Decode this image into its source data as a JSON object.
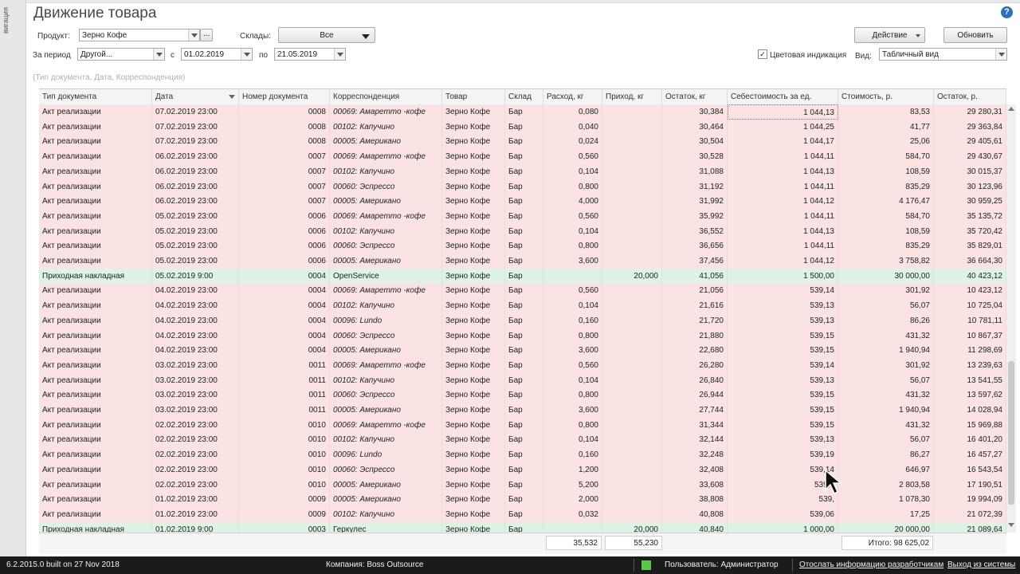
{
  "left_strip_text": "вигация",
  "title": "Движение товара",
  "form": {
    "product_label": "Продукт:",
    "product_value": "Зерно Кофе",
    "product_more": "...",
    "stores_label": "Склады:",
    "stores_value": "Все",
    "period_label": "За период",
    "period_value": "Другой...",
    "from_label": "с",
    "from_value": "01.02.2019",
    "to_label": "по",
    "to_value": "21.05.2019",
    "color_label": "Цветовая индикация",
    "view_label": "Вид:",
    "view_value": "Табличный вид",
    "action_btn": "Действие",
    "refresh_btn": "Обновить",
    "filter_placeholder": "(Тип документа, Дата, Корреспонденция)"
  },
  "columns": [
    "Тип документа",
    "Дата",
    "Номер документа",
    "Корреспонденция",
    "Товар",
    "Склад",
    "Расход, кг",
    "Приход, кг",
    "Остаток, кг",
    "Себестоимость за ед.",
    "Стоимость, р.",
    "Остаток, р."
  ],
  "rows": [
    {
      "kind": "sale",
      "type": "Акт реализации",
      "date": "07.02.2019 23:00",
      "num": "0008",
      "corr": "00069: Амаретто -кофе",
      "item": "Зерно Кофе",
      "store": "Бар",
      "out": "0,080",
      "in": "",
      "bal": "30,384",
      "unit": "1 044,13",
      "cost": "83,53",
      "balr": "29 280,31"
    },
    {
      "kind": "sale",
      "type": "Акт реализации",
      "date": "07.02.2019 23:00",
      "num": "0008",
      "corr": "00102: Капучино",
      "item": "Зерно Кофе",
      "store": "Бар",
      "out": "0,040",
      "in": "",
      "bal": "30,464",
      "unit": "1 044,25",
      "cost": "41,77",
      "balr": "29 363,84"
    },
    {
      "kind": "sale",
      "type": "Акт реализации",
      "date": "07.02.2019 23:00",
      "num": "0008",
      "corr": "00005: Американо",
      "item": "Зерно Кофе",
      "store": "Бар",
      "out": "0,024",
      "in": "",
      "bal": "30,504",
      "unit": "1 044,17",
      "cost": "25,06",
      "balr": "29 405,61"
    },
    {
      "kind": "sale",
      "type": "Акт реализации",
      "date": "06.02.2019 23:00",
      "num": "0007",
      "corr": "00069: Амаретто -кофе",
      "item": "Зерно Кофе",
      "store": "Бар",
      "out": "0,560",
      "in": "",
      "bal": "30,528",
      "unit": "1 044,11",
      "cost": "584,70",
      "balr": "29 430,67"
    },
    {
      "kind": "sale",
      "type": "Акт реализации",
      "date": "06.02.2019 23:00",
      "num": "0007",
      "corr": "00102: Капучино",
      "item": "Зерно Кофе",
      "store": "Бар",
      "out": "0,104",
      "in": "",
      "bal": "31,088",
      "unit": "1 044,13",
      "cost": "108,59",
      "balr": "30 015,37"
    },
    {
      "kind": "sale",
      "type": "Акт реализации",
      "date": "06.02.2019 23:00",
      "num": "0007",
      "corr": "00060: Эспрессо",
      "item": "Зерно Кофе",
      "store": "Бар",
      "out": "0,800",
      "in": "",
      "bal": "31,192",
      "unit": "1 044,11",
      "cost": "835,29",
      "balr": "30 123,96"
    },
    {
      "kind": "sale",
      "type": "Акт реализации",
      "date": "06.02.2019 23:00",
      "num": "0007",
      "corr": "00005: Американо",
      "item": "Зерно Кофе",
      "store": "Бар",
      "out": "4,000",
      "in": "",
      "bal": "31,992",
      "unit": "1 044,12",
      "cost": "4 176,47",
      "balr": "30 959,25"
    },
    {
      "kind": "sale",
      "type": "Акт реализации",
      "date": "05.02.2019 23:00",
      "num": "0006",
      "corr": "00069: Амаретто -кофе",
      "item": "Зерно Кофе",
      "store": "Бар",
      "out": "0,560",
      "in": "",
      "bal": "35,992",
      "unit": "1 044,11",
      "cost": "584,70",
      "balr": "35 135,72"
    },
    {
      "kind": "sale",
      "type": "Акт реализации",
      "date": "05.02.2019 23:00",
      "num": "0006",
      "corr": "00102: Капучино",
      "item": "Зерно Кофе",
      "store": "Бар",
      "out": "0,104",
      "in": "",
      "bal": "36,552",
      "unit": "1 044,13",
      "cost": "108,59",
      "balr": "35 720,42"
    },
    {
      "kind": "sale",
      "type": "Акт реализации",
      "date": "05.02.2019 23:00",
      "num": "0006",
      "corr": "00060: Эспрессо",
      "item": "Зерно Кофе",
      "store": "Бар",
      "out": "0,800",
      "in": "",
      "bal": "36,656",
      "unit": "1 044,11",
      "cost": "835,29",
      "balr": "35 829,01"
    },
    {
      "kind": "sale",
      "type": "Акт реализации",
      "date": "05.02.2019 23:00",
      "num": "0006",
      "corr": "00005: Американо",
      "item": "Зерно Кофе",
      "store": "Бар",
      "out": "3,600",
      "in": "",
      "bal": "37,456",
      "unit": "1 044,12",
      "cost": "3 758,82",
      "balr": "36 664,30"
    },
    {
      "kind": "inc",
      "type": "Приходная накладная",
      "date": "05.02.2019 9:00",
      "num": "0004",
      "corr": "OpenService",
      "item": "Зерно Кофе",
      "store": "Бар",
      "out": "",
      "in": "20,000",
      "bal": "41,056",
      "unit": "1 500,00",
      "cost": "30 000,00",
      "balr": "40 423,12"
    },
    {
      "kind": "sale",
      "type": "Акт реализации",
      "date": "04.02.2019 23:00",
      "num": "0004",
      "corr": "00069: Амаретто -кофе",
      "item": "Зерно Кофе",
      "store": "Бар",
      "out": "0,560",
      "in": "",
      "bal": "21,056",
      "unit": "539,14",
      "cost": "301,92",
      "balr": "10 423,12"
    },
    {
      "kind": "sale",
      "type": "Акт реализации",
      "date": "04.02.2019 23:00",
      "num": "0004",
      "corr": "00102: Капучино",
      "item": "Зерно Кофе",
      "store": "Бар",
      "out": "0,104",
      "in": "",
      "bal": "21,616",
      "unit": "539,13",
      "cost": "56,07",
      "balr": "10 725,04"
    },
    {
      "kind": "sale",
      "type": "Акт реализации",
      "date": "04.02.2019 23:00",
      "num": "0004",
      "corr": "00096: Lundo",
      "item": "Зерно Кофе",
      "store": "Бар",
      "out": "0,160",
      "in": "",
      "bal": "21,720",
      "unit": "539,13",
      "cost": "86,26",
      "balr": "10 781,11"
    },
    {
      "kind": "sale",
      "type": "Акт реализации",
      "date": "04.02.2019 23:00",
      "num": "0004",
      "corr": "00060: Эспрессо",
      "item": "Зерно Кофе",
      "store": "Бар",
      "out": "0,800",
      "in": "",
      "bal": "21,880",
      "unit": "539,15",
      "cost": "431,32",
      "balr": "10 867,37"
    },
    {
      "kind": "sale",
      "type": "Акт реализации",
      "date": "04.02.2019 23:00",
      "num": "0004",
      "corr": "00005: Американо",
      "item": "Зерно Кофе",
      "store": "Бар",
      "out": "3,600",
      "in": "",
      "bal": "22,680",
      "unit": "539,15",
      "cost": "1 940,94",
      "balr": "11 298,69"
    },
    {
      "kind": "sale",
      "type": "Акт реализации",
      "date": "03.02.2019 23:00",
      "num": "0011",
      "corr": "00069: Амаретто -кофе",
      "item": "Зерно Кофе",
      "store": "Бар",
      "out": "0,560",
      "in": "",
      "bal": "26,280",
      "unit": "539,14",
      "cost": "301,92",
      "balr": "13 239,63"
    },
    {
      "kind": "sale",
      "type": "Акт реализации",
      "date": "03.02.2019 23:00",
      "num": "0011",
      "corr": "00102: Капучино",
      "item": "Зерно Кофе",
      "store": "Бар",
      "out": "0,104",
      "in": "",
      "bal": "26,840",
      "unit": "539,13",
      "cost": "56,07",
      "balr": "13 541,55"
    },
    {
      "kind": "sale",
      "type": "Акт реализации",
      "date": "03.02.2019 23:00",
      "num": "0011",
      "corr": "00060: Эспрессо",
      "item": "Зерно Кофе",
      "store": "Бар",
      "out": "0,800",
      "in": "",
      "bal": "26,944",
      "unit": "539,15",
      "cost": "431,32",
      "balr": "13 597,62"
    },
    {
      "kind": "sale",
      "type": "Акт реализации",
      "date": "03.02.2019 23:00",
      "num": "0011",
      "corr": "00005: Американо",
      "item": "Зерно Кофе",
      "store": "Бар",
      "out": "3,600",
      "in": "",
      "bal": "27,744",
      "unit": "539,15",
      "cost": "1 940,94",
      "balr": "14 028,94"
    },
    {
      "kind": "sale",
      "type": "Акт реализации",
      "date": "02.02.2019 23:00",
      "num": "0010",
      "corr": "00069: Амаретто -кофе",
      "item": "Зерно Кофе",
      "store": "Бар",
      "out": "0,800",
      "in": "",
      "bal": "31,344",
      "unit": "539,15",
      "cost": "431,32",
      "balr": "15 969,88"
    },
    {
      "kind": "sale",
      "type": "Акт реализации",
      "date": "02.02.2019 23:00",
      "num": "0010",
      "corr": "00102: Капучино",
      "item": "Зерно Кофе",
      "store": "Бар",
      "out": "0,104",
      "in": "",
      "bal": "32,144",
      "unit": "539,13",
      "cost": "56,07",
      "balr": "16 401,20"
    },
    {
      "kind": "sale",
      "type": "Акт реализации",
      "date": "02.02.2019 23:00",
      "num": "0010",
      "corr": "00096: Lundo",
      "item": "Зерно Кофе",
      "store": "Бар",
      "out": "0,160",
      "in": "",
      "bal": "32,248",
      "unit": "539,19",
      "cost": "86,27",
      "balr": "16 457,27"
    },
    {
      "kind": "sale",
      "type": "Акт реализации",
      "date": "02.02.2019 23:00",
      "num": "0010",
      "corr": "00060: Эспрессо",
      "item": "Зерно Кофе",
      "store": "Бар",
      "out": "1,200",
      "in": "",
      "bal": "32,408",
      "unit": "539,14",
      "cost": "646,97",
      "balr": "16 543,54"
    },
    {
      "kind": "sale",
      "type": "Акт реализации",
      "date": "02.02.2019 23:00",
      "num": "0010",
      "corr": "00005: Американо",
      "item": "Зерно Кофе",
      "store": "Бар",
      "out": "5,200",
      "in": "",
      "bal": "33,608",
      "unit": "539,1",
      "cost": "2 803,58",
      "balr": "17 190,51"
    },
    {
      "kind": "sale",
      "type": "Акт реализации",
      "date": "01.02.2019 23:00",
      "num": "0009",
      "corr": "00005: Американо",
      "item": "Зерно Кофе",
      "store": "Бар",
      "out": "2,000",
      "in": "",
      "bal": "38,808",
      "unit": "539,",
      "cost": "1 078,30",
      "balr": "19 994,09"
    },
    {
      "kind": "sale",
      "type": "Акт реализации",
      "date": "01.02.2019 23:00",
      "num": "0009",
      "corr": "00102: Капучино",
      "item": "Зерно Кофе",
      "store": "Бар",
      "out": "0,032",
      "in": "",
      "bal": "40,808",
      "unit": "539,06",
      "cost": "17,25",
      "balr": "21 072,39"
    },
    {
      "kind": "inc",
      "type": "Приходная накладная",
      "date": "01.02.2019 9:00",
      "num": "0003",
      "corr": "Геркулес",
      "item": "Зерно Кофе",
      "store": "Бар",
      "out": "",
      "in": "20,000",
      "bal": "40,840",
      "unit": "1 000,00",
      "cost": "20 000,00",
      "balr": "21 089,64"
    }
  ],
  "totals": {
    "out": "35,532",
    "in": "55,230",
    "cost": "Итого: 98 625,02"
  },
  "status": {
    "version": "6.2.2015.0 built on 27 Nov 2018",
    "company": "Компания: Boss Outsource",
    "user": "Пользователь: Администратор",
    "report_link": "Отослать информацию разработчикам",
    "exit_link": "Выход из системы"
  },
  "colors": {
    "sale_row": "#fbe3e3",
    "income_row": "#dff2e6",
    "status_bar": "#1b1b1b",
    "help": "#2f6fb5"
  }
}
